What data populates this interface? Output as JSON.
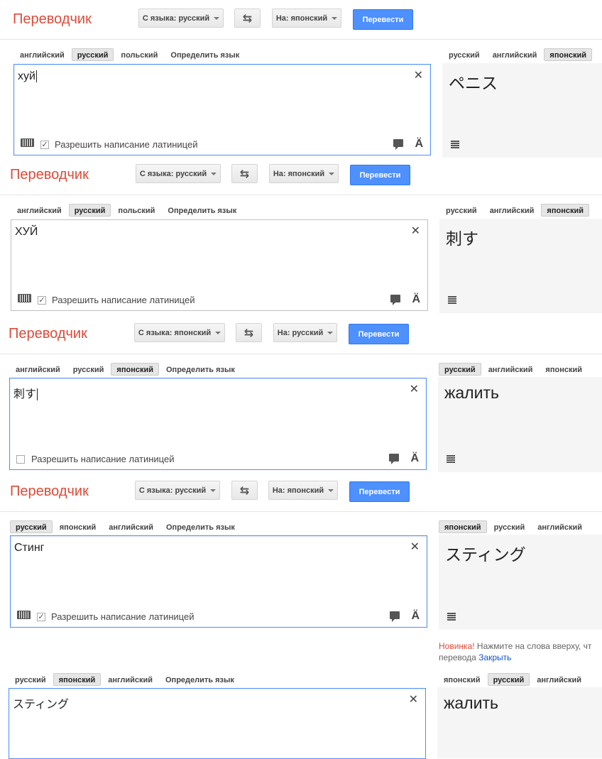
{
  "panels": [
    {
      "title": "Переводчик",
      "from_label": "С языка: русский",
      "to_label": "На: японский",
      "translate_label": "Перевести",
      "src_tabs": [
        "английский",
        "русский",
        "польский",
        "Определить язык"
      ],
      "src_selected": 1,
      "dst_tabs": [
        "русский",
        "английский",
        "японский"
      ],
      "dst_selected": 2,
      "input_text": "хуй",
      "show_cursor": true,
      "focused": true,
      "latin_label": "Разрешить написание латиницей",
      "latin_checked": true,
      "show_keyboard": true,
      "output_text": "ペニス"
    },
    {
      "title": "Переводчик",
      "from_label": "С языка: русский",
      "to_label": "На: японский",
      "translate_label": "Перевести",
      "src_tabs": [
        "английский",
        "русский",
        "польский",
        "Определить язык"
      ],
      "src_selected": 1,
      "dst_tabs": [
        "русский",
        "английский",
        "японский"
      ],
      "dst_selected": 2,
      "input_text": "ХУЙ",
      "show_cursor": false,
      "focused": false,
      "latin_label": "Разрешить написание латиницей",
      "latin_checked": true,
      "show_keyboard": true,
      "output_text": "刺す"
    },
    {
      "title": "Переводчик",
      "from_label": "С языка: японский",
      "to_label": "На: русский",
      "translate_label": "Перевести",
      "src_tabs": [
        "английский",
        "русский",
        "японский",
        "Определить язык"
      ],
      "src_selected": 2,
      "dst_tabs": [
        "русский",
        "английский",
        "японский"
      ],
      "dst_selected": 0,
      "input_text": "刺す",
      "show_cursor": true,
      "focused": true,
      "latin_label": "Разрешить написание латиницей",
      "latin_checked": false,
      "show_keyboard": false,
      "output_text": "жалить"
    },
    {
      "title": "Переводчик",
      "from_label": "С языка: русский",
      "to_label": "На: японский",
      "translate_label": "Перевести",
      "src_tabs": [
        "русский",
        "японский",
        "английский",
        "Определить язык"
      ],
      "src_selected": 0,
      "dst_tabs": [
        "японский",
        "русский",
        "английский"
      ],
      "dst_selected": 0,
      "input_text": "Стинг",
      "show_cursor": false,
      "focused": true,
      "latin_label": "Разрешить написание латиницей",
      "latin_checked": true,
      "show_keyboard": true,
      "output_text": "スティング"
    },
    {
      "src_tabs": [
        "русский",
        "японский",
        "английский",
        "Определить язык"
      ],
      "src_selected": 1,
      "dst_tabs": [
        "японский",
        "русский",
        "английский"
      ],
      "dst_selected": 1,
      "input_text": "スティング",
      "show_cursor": false,
      "focused": true,
      "output_text": "жалить"
    }
  ],
  "notice": {
    "new_label": "Новинка!",
    "text_line1": "Нажмите на слова вверху, чт",
    "text_line2": "перевода",
    "close_link": "Закрыть"
  },
  "colors": {
    "title": "#dd4b39",
    "translate_button": "#4d90fe",
    "focus_border": "#4d90fe",
    "output_bg": "#f5f5f5",
    "link": "#1155cc"
  }
}
